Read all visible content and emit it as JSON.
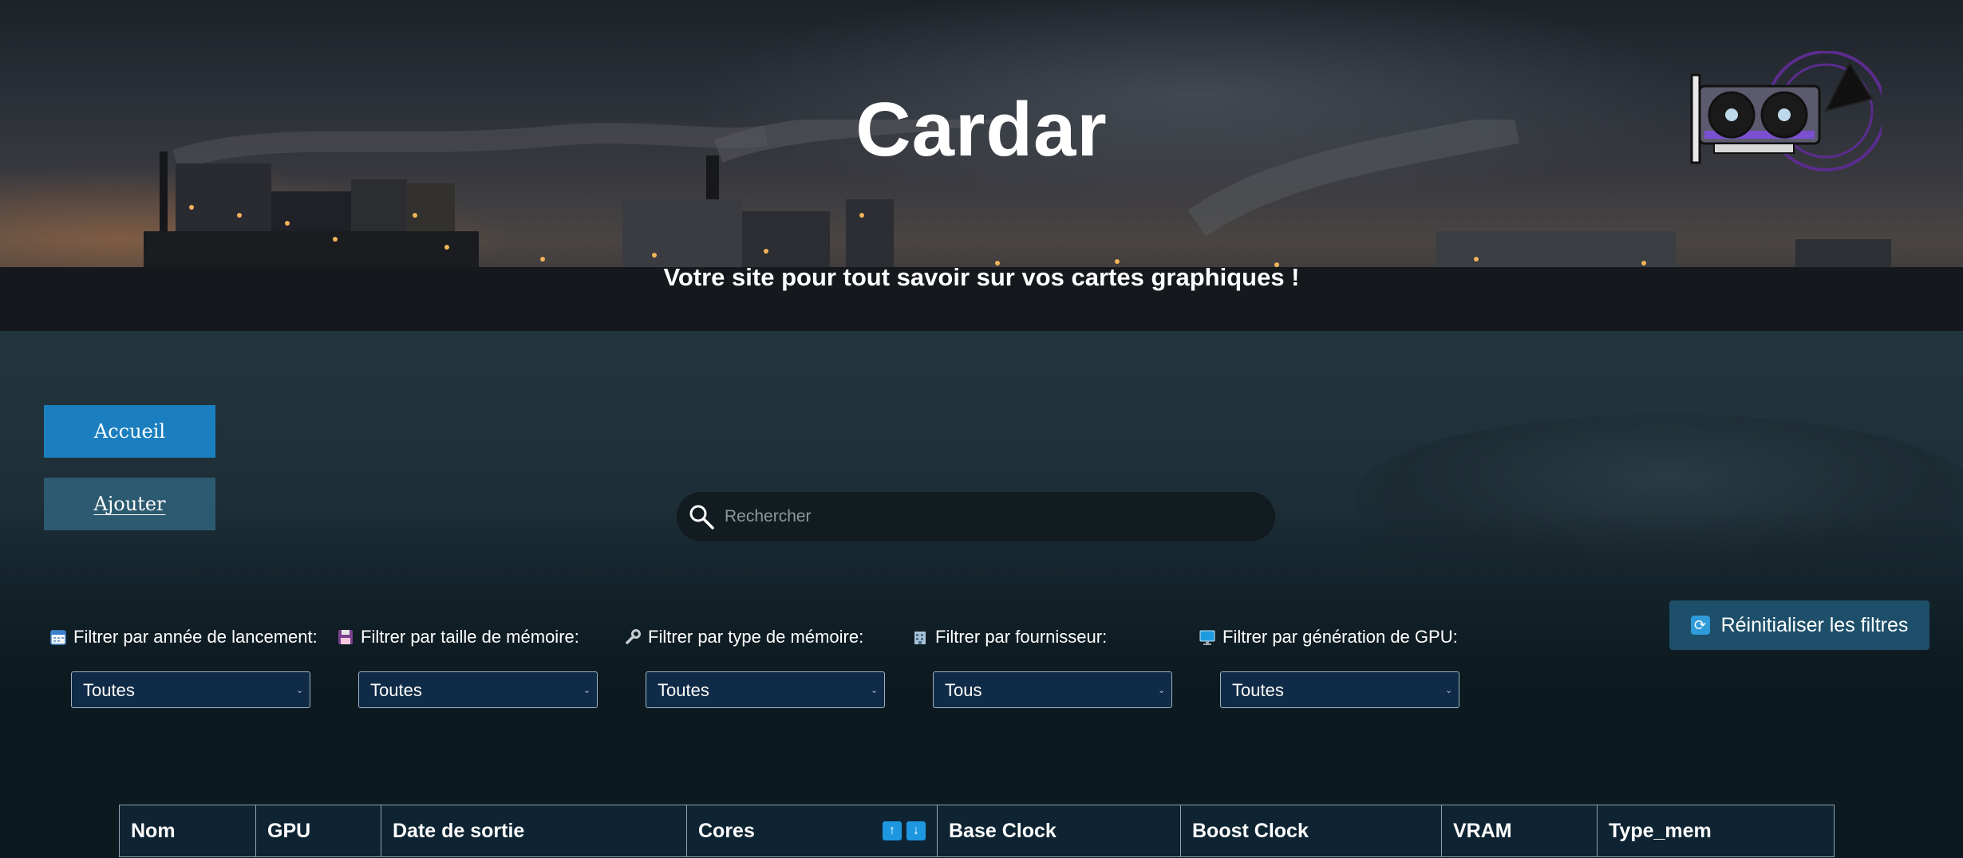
{
  "header": {
    "title": "Cardar",
    "tagline": "Votre site pour tout savoir sur vos cartes graphiques !",
    "logo_icon": "gpu-card-icon"
  },
  "nav": {
    "home_label": "Accueil",
    "add_label": "Ajouter"
  },
  "search": {
    "placeholder": "Rechercher",
    "value": "",
    "icon": "search-icon"
  },
  "reset": {
    "label": "Réinitialiser les filtres",
    "icon": "refresh-icon"
  },
  "filters": [
    {
      "label": "Filtrer par année de lancement:",
      "icon": "calendar-icon",
      "selected": "Toutes"
    },
    {
      "label": "Filtrer par taille de mémoire:",
      "icon": "floppy-disk-icon",
      "selected": "Toutes"
    },
    {
      "label": "Filtrer par type de mémoire:",
      "icon": "wrench-icon",
      "selected": "Toutes"
    },
    {
      "label": "Filtrer par fournisseur:",
      "icon": "building-icon",
      "selected": "Tous"
    },
    {
      "label": "Filtrer par génération de GPU:",
      "icon": "monitor-icon",
      "selected": "Toutes"
    }
  ],
  "table": {
    "columns": [
      "Nom",
      "GPU",
      "Date de sortie",
      "Cores",
      "Base Clock",
      "Boost Clock",
      "VRAM",
      "Type_mem"
    ],
    "sort_up_icon": "arrow-up-icon",
    "sort_down_icon": "arrow-down-icon"
  },
  "colors": {
    "primary_button": "#1b7fbf",
    "secondary_button": "#2c5a70",
    "select_bg": "#102b47",
    "sort_accent": "#1e96e0",
    "page_bg": "#0c1a1f"
  }
}
